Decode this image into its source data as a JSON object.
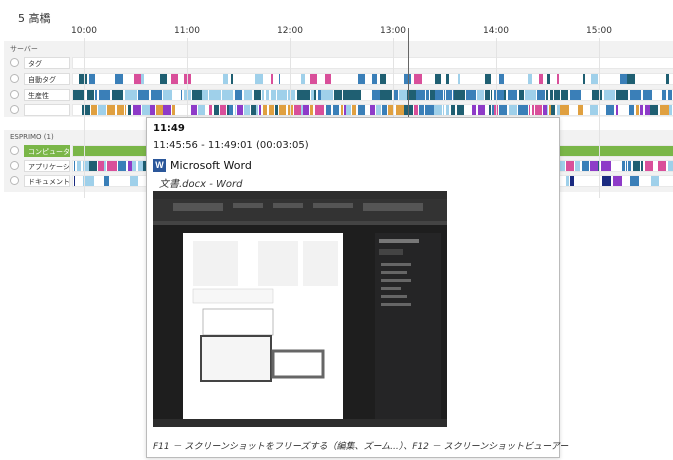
{
  "header": {
    "user": "5  高橋"
  },
  "timeline": {
    "ticks": [
      "10:00",
      "11:00",
      "12:00",
      "13:00",
      "14:00",
      "15:00"
    ]
  },
  "groups": [
    {
      "title": "サーバー",
      "rows": [
        {
          "label": "タグ",
          "highlight": false,
          "track": "empty"
        },
        {
          "label": "自動タグ",
          "highlight": false,
          "track": "tags"
        },
        {
          "label": "生産性",
          "highlight": false,
          "track": "productivity"
        },
        {
          "label": "",
          "highlight": false,
          "track": "colorful"
        }
      ]
    },
    {
      "title": "ESPRIMO (1)",
      "rows": [
        {
          "label": "コンピュータの使用",
          "highlight": true,
          "track": "usage"
        },
        {
          "label": "アプリケーション",
          "highlight": false,
          "track": "apps"
        },
        {
          "label": "ドキュメント",
          "highlight": false,
          "track": "docs"
        }
      ]
    }
  ],
  "tooltip": {
    "time": "11:49",
    "range": "11:45:56 - 11:49:01 (00:03:05)",
    "app_icon_letter": "W",
    "app_name": "Microsoft Word",
    "document": "文書.docx - Word",
    "footer": "F11 － スクリーンショットをフリーズする（編集、ズーム...）、F12 － スクリーンショットビューアー"
  },
  "colors": {
    "dark_teal": "#1f5f72",
    "steel_blue": "#3a7fb8",
    "light_blue": "#9fd0ea",
    "purple": "#8e3bc8",
    "pink": "#d94f9a",
    "green": "#7ab648",
    "navy": "#1a2a80"
  }
}
